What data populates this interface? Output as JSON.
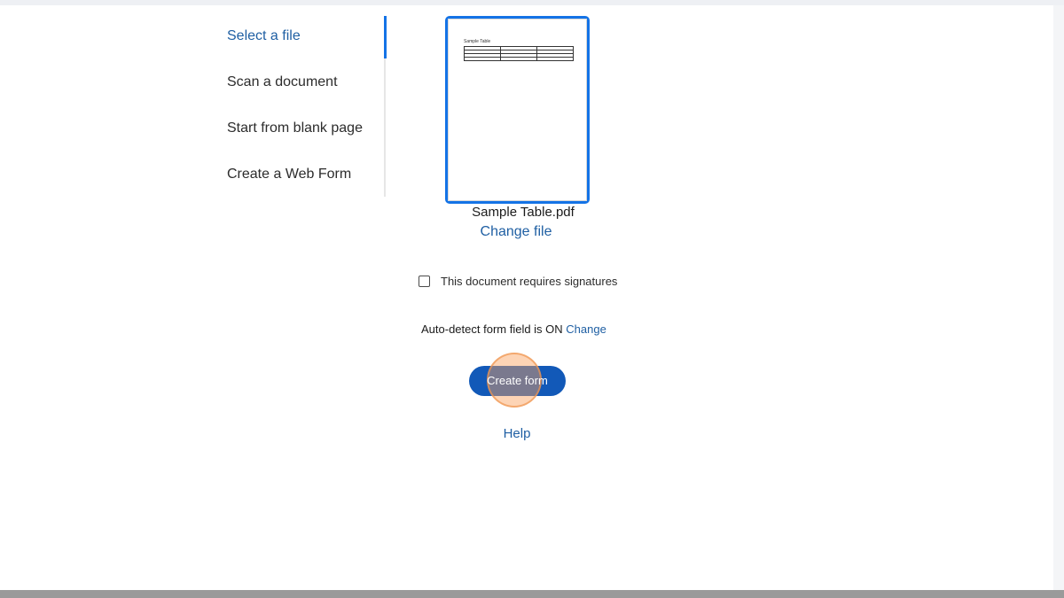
{
  "nav": {
    "items": [
      {
        "label": "Select a file",
        "active": true
      },
      {
        "label": "Scan a document",
        "active": false
      },
      {
        "label": "Start from blank page",
        "active": false
      },
      {
        "label": "Create a Web Form",
        "active": false
      }
    ]
  },
  "preview": {
    "document_title": "Sample Table",
    "file_name": "Sample Table.pdf",
    "change_file_label": "Change file"
  },
  "options": {
    "signature_label": "This document requires signatures",
    "signature_checked": false,
    "auto_detect_text": "Auto-detect form field is ON",
    "auto_detect_change_label": "Change"
  },
  "actions": {
    "create_form_label": "Create form",
    "help_label": "Help"
  },
  "colors": {
    "accent": "#1473e6",
    "link": "#1f5fa3",
    "primary_button": "#1259b8",
    "click_marker": "#faa05a"
  }
}
